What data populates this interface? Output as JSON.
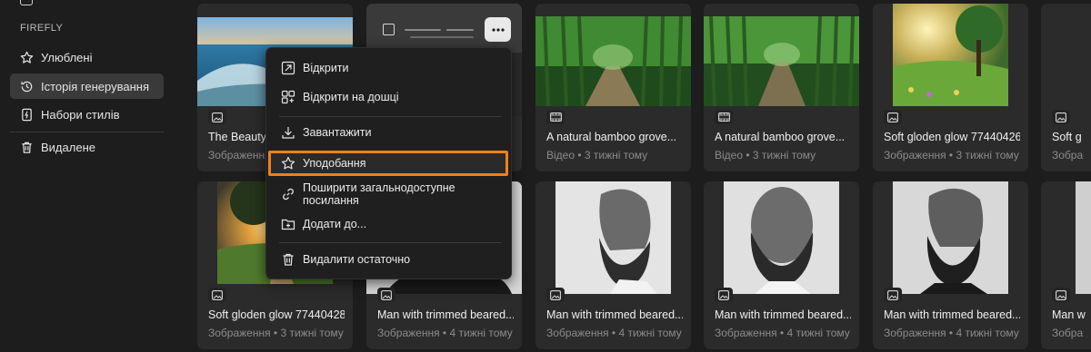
{
  "sidebar": {
    "section_label": "FIREFLY",
    "items": [
      {
        "label": "Улюблені",
        "icon": "star-icon"
      },
      {
        "label": "Історія генерування",
        "icon": "history-icon"
      },
      {
        "label": "Набори стилів",
        "icon": "style-kit-icon"
      },
      {
        "label": "Видалене",
        "icon": "trash-icon"
      }
    ]
  },
  "cards": [
    {
      "title": "The Beauty of",
      "meta": "Зображення • 3",
      "kind": "image-icon"
    },
    {
      "title": "",
      "meta": "",
      "kind": "image-icon"
    },
    {
      "title": "A natural bamboo grove...",
      "meta": "Відео • 3 тижні тому",
      "kind": "video-icon"
    },
    {
      "title": "A natural bamboo grove...",
      "meta": "Відео • 3 тижні тому",
      "kind": "video-icon"
    },
    {
      "title": "Soft gloden glow 77440426...",
      "meta": "Зображення • 3 тижні тому",
      "kind": "image-icon"
    },
    {
      "title": "Soft g",
      "meta": "Зобра",
      "kind": "image-icon"
    },
    {
      "title": "Soft gloden glow 77440428...",
      "meta": "Зображення • 3 тижні тому",
      "kind": "image-icon"
    },
    {
      "title": "Man with trimmed beared...",
      "meta": "Зображення • 4 тижні тому",
      "kind": "image-icon"
    },
    {
      "title": "Man with trimmed beared...",
      "meta": "Зображення • 4 тижні тому",
      "kind": "image-icon"
    },
    {
      "title": "Man with trimmed beared...",
      "meta": "Зображення • 4 тижні тому",
      "kind": "image-icon"
    },
    {
      "title": "Man with trimmed beared...",
      "meta": "Зображення • 4 тижні тому",
      "kind": "image-icon"
    },
    {
      "title": "Man w",
      "meta": "Зобра",
      "kind": "image-icon"
    }
  ],
  "menu": {
    "items": [
      {
        "label": "Відкрити",
        "icon": "open-icon"
      },
      {
        "label": "Відкрити на дошці",
        "icon": "board-icon"
      },
      {
        "label": "Завантажити",
        "icon": "download-icon"
      },
      {
        "label": "Уподобання",
        "icon": "star-icon"
      },
      {
        "label": "Поширити загальнодоступне посилання",
        "icon": "link-icon"
      },
      {
        "label": "Додати до...",
        "icon": "add-to-folder-icon"
      },
      {
        "label": "Видалити остаточно",
        "icon": "trash-icon"
      }
    ]
  },
  "colors": {
    "background": "#1d1d1d",
    "card": "#2b2b2b",
    "focus_outline": "#f07f1a",
    "menu": "#1f1f1f"
  }
}
